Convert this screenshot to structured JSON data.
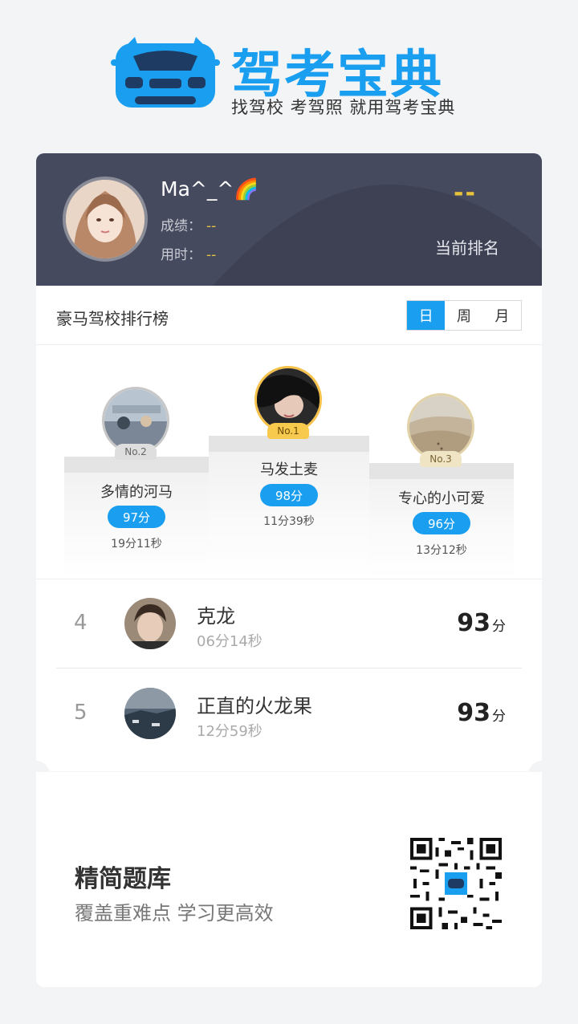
{
  "brand": {
    "title": "驾考宝典",
    "slogan": "找驾校 考驾照 就用驾考宝典",
    "primary_color": "#1a9ef0"
  },
  "user": {
    "name": "Ma^_^🌈",
    "score_label": "成绩：",
    "score_value": "--",
    "time_label": "用时：",
    "time_value": "--",
    "rank_value": "--",
    "rank_label": "当前排名"
  },
  "board": {
    "title": "豪马驾校排行榜",
    "tabs": [
      "日",
      "周",
      "月"
    ],
    "active_tab": "日"
  },
  "podium": [
    {
      "rank_tag": "No.1",
      "name": "马发土麦",
      "score": "98分",
      "time": "11分39秒"
    },
    {
      "rank_tag": "No.2",
      "name": "多情的河马",
      "score": "97分",
      "time": "19分11秒"
    },
    {
      "rank_tag": "No.3",
      "name": "专心的小可爱",
      "score": "96分",
      "time": "13分12秒"
    }
  ],
  "ranking_list": [
    {
      "rank": "4",
      "name": "克龙",
      "time": "06分14秒",
      "score": "93",
      "unit": "分"
    },
    {
      "rank": "5",
      "name": "正直的火龙果",
      "time": "12分59秒",
      "score": "93",
      "unit": "分"
    }
  ],
  "promo": {
    "title": "精简题库",
    "subtitle": "覆盖重难点 学习更高效"
  }
}
